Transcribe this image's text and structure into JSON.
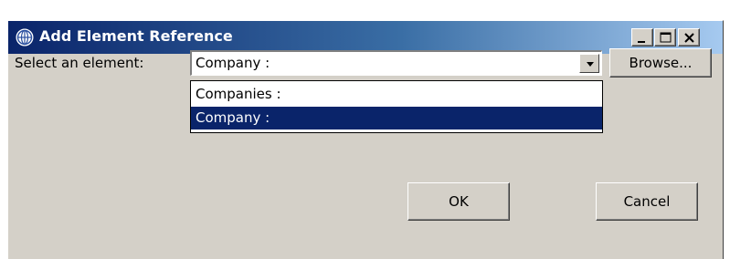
{
  "window": {
    "title": "Add Element Reference",
    "icon": "globe-icon",
    "controls": [
      "minimize",
      "maximize",
      "close"
    ]
  },
  "form": {
    "select_label": "Select an element:",
    "selected_value": "Company :",
    "browse_label": "Browse..."
  },
  "dropdown": {
    "options": [
      "Companies :",
      "Company :"
    ],
    "highlighted_index": 1
  },
  "buttons": {
    "ok_label": "OK",
    "cancel_label": "Cancel"
  },
  "colors": {
    "titlebar_start": "#0a246a",
    "titlebar_end": "#a6caf0",
    "dialog_bg": "#d4d0c8",
    "selection_bg": "#0a246a"
  }
}
